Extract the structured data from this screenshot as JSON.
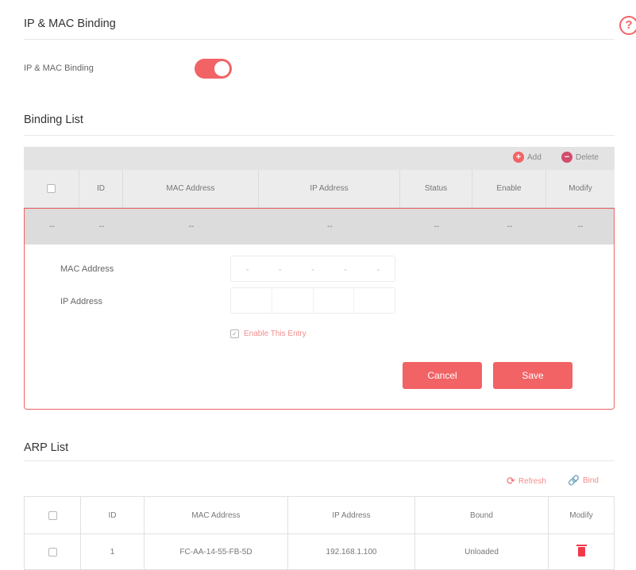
{
  "header": {
    "title": "IP & MAC Binding",
    "help_icon": "?"
  },
  "binding_toggle": {
    "label": "IP & MAC Binding",
    "enabled": true
  },
  "binding_list": {
    "title": "Binding List",
    "toolbar": {
      "add_label": "Add",
      "delete_label": "Delete",
      "add_icon": "plus-circle",
      "delete_icon": "minus-circle"
    },
    "columns": [
      "ID",
      "MAC Address",
      "IP Address",
      "Status",
      "Enable",
      "Modify"
    ],
    "empty_row": [
      "--",
      "--",
      "--",
      "--",
      "--",
      "--",
      "--"
    ],
    "form": {
      "mac_label": "MAC Address",
      "ip_label": "IP Address",
      "mac_separators": [
        "-",
        "-",
        "-",
        "-",
        "-"
      ],
      "enable_label": "Enable This Entry",
      "enable_checked": true,
      "cancel_label": "Cancel",
      "save_label": "Save"
    }
  },
  "arp_list": {
    "title": "ARP List",
    "toolbar": {
      "refresh_label": "Refresh",
      "bind_label": "Bind"
    },
    "columns": [
      "ID",
      "MAC Address",
      "IP Address",
      "Bound",
      "Modify"
    ],
    "rows": [
      {
        "id": "1",
        "mac": "FC-AA-14-55-FB-5D",
        "ip": "192.168.1.100",
        "bound": "Unloaded"
      }
    ]
  },
  "colors": {
    "accent": "#f26366",
    "table_header": "#ececec",
    "toolbar": "#e3e3e3"
  }
}
